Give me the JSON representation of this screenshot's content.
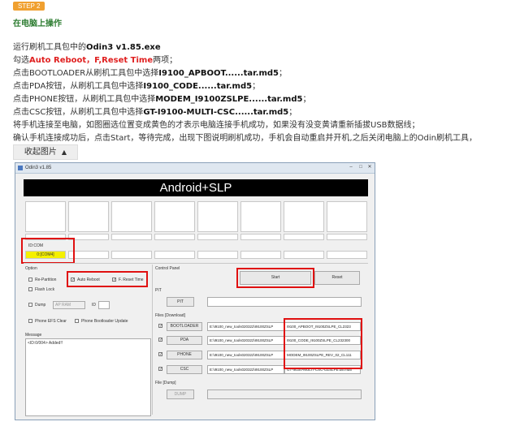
{
  "step_badge": "STEP 2",
  "step_title": "在电脑上操作",
  "instructions": [
    {
      "parts": [
        {
          "t": "运行刷机工具包中的"
        },
        {
          "t": "Odin3 v1.85.exe",
          "b": true
        }
      ]
    },
    {
      "parts": [
        {
          "t": "勾选"
        },
        {
          "t": "Auto Reboot",
          "red": true
        },
        {
          "t": "，",
          "red": true
        },
        {
          "t": "F,Reset Time",
          "red": true
        },
        {
          "t": "两项；"
        }
      ]
    },
    {
      "parts": [
        {
          "t": "点击BOOTLOADER从刷机工具包中选择"
        },
        {
          "t": "I9100_APBOOT......tar.md5",
          "b": true
        },
        {
          "t": "；"
        }
      ]
    },
    {
      "parts": [
        {
          "t": "点击PDA按钮，从刷机工具包中选择"
        },
        {
          "t": "I9100_CODE......tar.md5",
          "b": true
        },
        {
          "t": "；"
        }
      ]
    },
    {
      "parts": [
        {
          "t": "点击PHONE按钮，从刷机工具包中选择"
        },
        {
          "t": "MODEM_I9100ZSLPE......tar.md5",
          "b": true
        },
        {
          "t": "；"
        }
      ]
    },
    {
      "parts": [
        {
          "t": "点击CSC按钮，从刷机工具包中选择"
        },
        {
          "t": "GT-I9100-MULTI-CSC......tar.md5",
          "b": true
        },
        {
          "t": "；"
        }
      ]
    },
    {
      "parts": [
        {
          "t": "将手机连接至电脑，如图圈选位置变成黄色的才表示电脑连接手机成功，如果没有没变黄请重新插拔USB数据线；"
        }
      ]
    },
    {
      "parts": [
        {
          "t": "确认手机连接成功后，点击Start，等待完成，出现下图说明刷机成功，手机会自动重启并开机,之后关闭电脑上的Odin刷机工具，"
        }
      ]
    }
  ],
  "collapse_button": {
    "label": "收起图片",
    "icon": "triangle-up-icon"
  },
  "odin": {
    "title": "Odin3 v1.85",
    "banner": "Android+SLP",
    "idcom_label": "ID:COM",
    "idcom_active": "0:[COM4]",
    "option_label": "Option",
    "options": {
      "re_partition": "Re-Partition",
      "auto_reboot": "Auto Reboot",
      "f_reset_time": "F. Reset Time",
      "flash_lock": "Flash Lock",
      "dump": "Dump",
      "dump_select": "AP RAM",
      "id_label": "ID",
      "phone_efs_clear": "Phone EFS Clear",
      "phone_bootloader_update": "Phone Bootloader Update"
    },
    "message_label": "Message",
    "message_text": "<ID:0/004> Added!!",
    "control_panel_label": "Control Panel",
    "start_label": "Start",
    "reset_label": "Reset",
    "pit_group_label": "PIT",
    "pit_button": "PIT",
    "files_label": "Files [Download]",
    "files": [
      {
        "button": "BOOTLOADER",
        "path": "E:\\I9100_new_tools020322\\I9100ZSLP",
        "file": "I9100_APBOOT_I9100ZSLPE_CL2323"
      },
      {
        "button": "PDA",
        "path": "E:\\I9100_new_tools020322\\I9100ZSLP",
        "file": "I9100_CODE_I9100ZSLPE_CL232300"
      },
      {
        "button": "PHONE",
        "path": "E:\\I9100_new_tools020322\\I9100ZSLP",
        "file": "MODEM_I9100ZSLPE_REV_02_CL111"
      },
      {
        "button": "CSC",
        "path": "E:\\I9100_new_tools020322\\I9100ZSLP",
        "file": "GT-I9100-MULTI-CSC-OZSLPE.tar.md5"
      }
    ],
    "file_dump_label": "File [Dump]",
    "dump_button": "DUMP",
    "colors": {
      "banner_bg": "#000000",
      "active_port": "#f5f000",
      "highlight": "#e01010"
    }
  }
}
